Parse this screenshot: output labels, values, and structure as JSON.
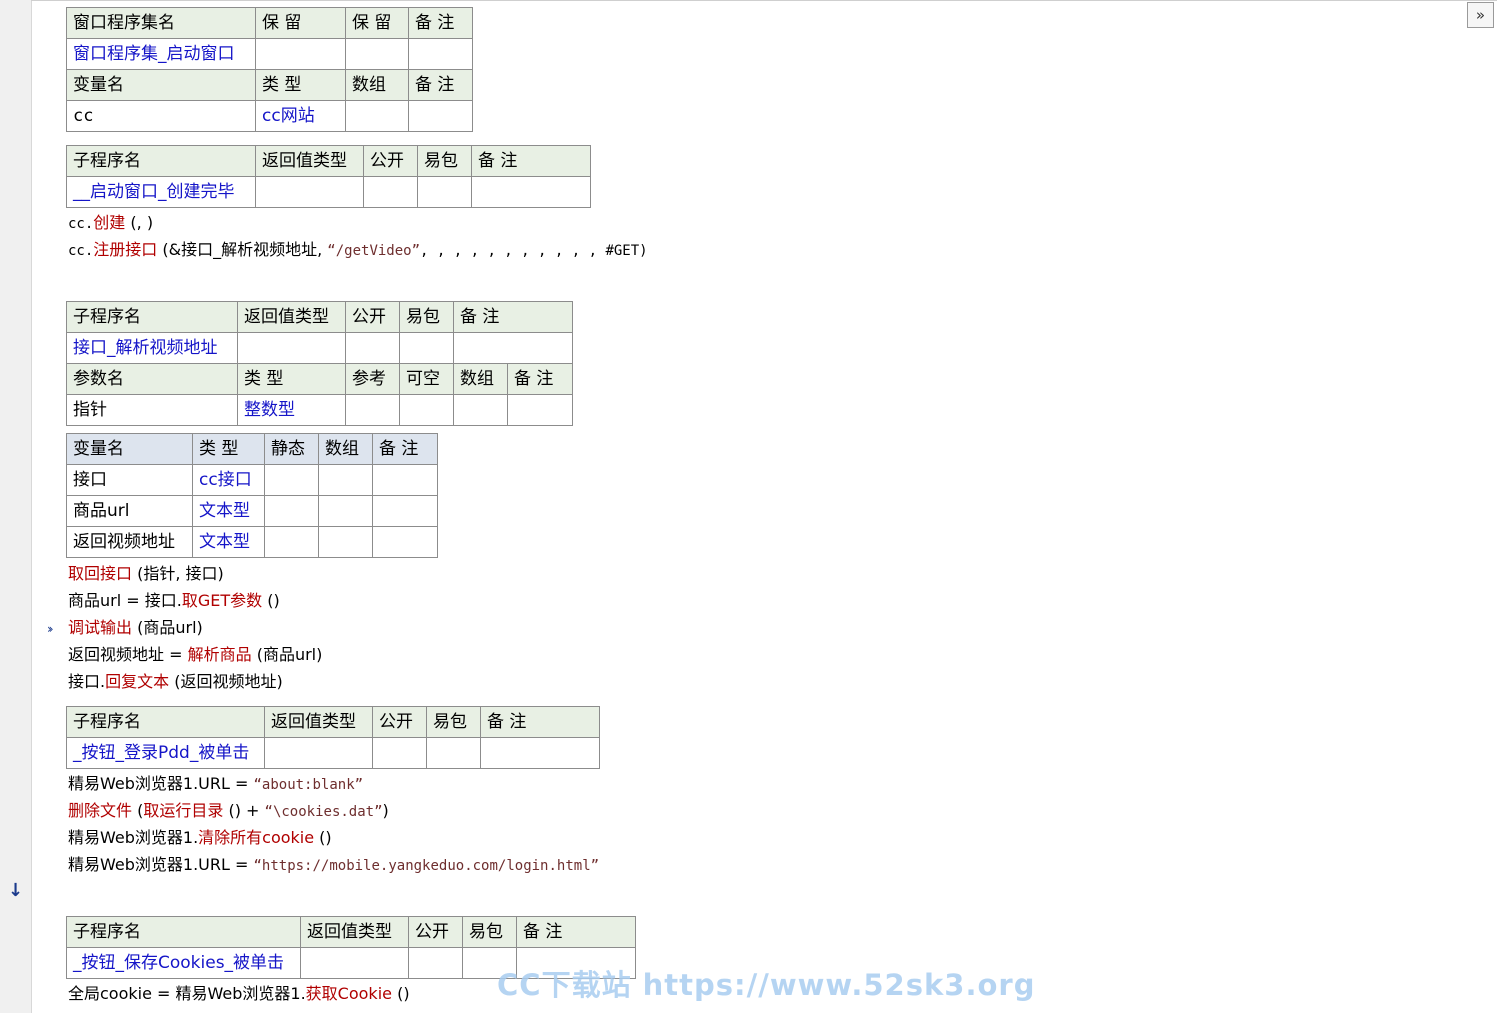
{
  "toolbar": {
    "expand_label": "»"
  },
  "assembly": {
    "headers": [
      "窗口程序集名",
      "保 留",
      "保 留",
      "备 注"
    ],
    "row": [
      "窗口程序集_启动窗口",
      "",
      "",
      ""
    ],
    "var_headers": [
      "变量名",
      "类 型",
      "数组",
      "备 注"
    ],
    "var_row": [
      "cc",
      "cc网站",
      "",
      ""
    ]
  },
  "sub1": {
    "headers": [
      "子程序名",
      "返回值类型",
      "公开",
      "易包",
      "备 注"
    ],
    "row": [
      "__启动窗口_创建完毕",
      "",
      "",
      "",
      ""
    ],
    "code": [
      {
        "obj": "cc.",
        "fn": "创建",
        "args": " (, )"
      },
      {
        "obj": "cc.",
        "fn": "注册接口",
        "args_pre": " (&接口_解析视频地址, ",
        "str": "“/getVideo”",
        "args_post": ", , , , , , , , , , , #GET)"
      }
    ]
  },
  "sub2": {
    "headers": [
      "子程序名",
      "返回值类型",
      "公开",
      "易包",
      "备 注"
    ],
    "row": [
      "接口_解析视频地址",
      "",
      "",
      "",
      ""
    ],
    "param_headers": [
      "参数名",
      "类 型",
      "参考",
      "可空",
      "数组",
      "备 注"
    ],
    "param_row": [
      "指针",
      "整数型",
      "",
      "",
      "",
      ""
    ],
    "var_headers": [
      "变量名",
      "类 型",
      "静态",
      "数组",
      "备 注"
    ],
    "var_rows": [
      [
        "接口",
        "cc接口",
        "",
        "",
        ""
      ],
      [
        "商品url",
        "文本型",
        "",
        "",
        ""
      ],
      [
        "返回视频地址",
        "文本型",
        "",
        "",
        ""
      ]
    ],
    "code": [
      {
        "fn": "取回接口",
        "rest": " (指针, 接口)"
      },
      {
        "pre": "商品url = 接口.",
        "fn": "取GET参数",
        "rest": " ()"
      },
      {
        "fn": "调试输出",
        "rest": " (商品url)"
      },
      {
        "pre": "返回视频地址 = ",
        "fn": "解析商品",
        "rest": " (商品url)"
      },
      {
        "pre": "接口.",
        "fn": "回复文本",
        "rest": " (返回视频地址)"
      }
    ]
  },
  "sub3": {
    "headers": [
      "子程序名",
      "返回值类型",
      "公开",
      "易包",
      "备 注"
    ],
    "row": [
      "_按钮_登录Pdd_被单击",
      "",
      "",
      "",
      ""
    ],
    "code": [
      {
        "pre": "精易Web浏览器1.URL = ",
        "str": "“about:blank”"
      },
      {
        "fn": "删除文件",
        "mid": " (",
        "fn2": "取运行目录",
        "rest_pre": " () + ",
        "str": "“\\cookies.dat”",
        "rest": ")"
      },
      {
        "pre": "精易Web浏览器1.",
        "fn": "清除所有cookie",
        "rest": " ()"
      },
      {
        "pre": "精易Web浏览器1.URL = ",
        "str": "“https://mobile.yangkeduo.com/login.html”"
      }
    ]
  },
  "sub4": {
    "headers": [
      "子程序名",
      "返回值类型",
      "公开",
      "易包",
      "备 注"
    ],
    "row": [
      "_按钮_保存Cookies_被单击",
      "",
      "",
      "",
      ""
    ],
    "code": [
      {
        "pre": "全局cookie = 精易Web浏览器1.",
        "fn": "获取Cookie",
        "rest": " ()"
      }
    ]
  },
  "watermark": "CC下载站 https://www.52sk3.org",
  "markers": {
    "run_arrow": "››",
    "down_arrow": "↓"
  }
}
